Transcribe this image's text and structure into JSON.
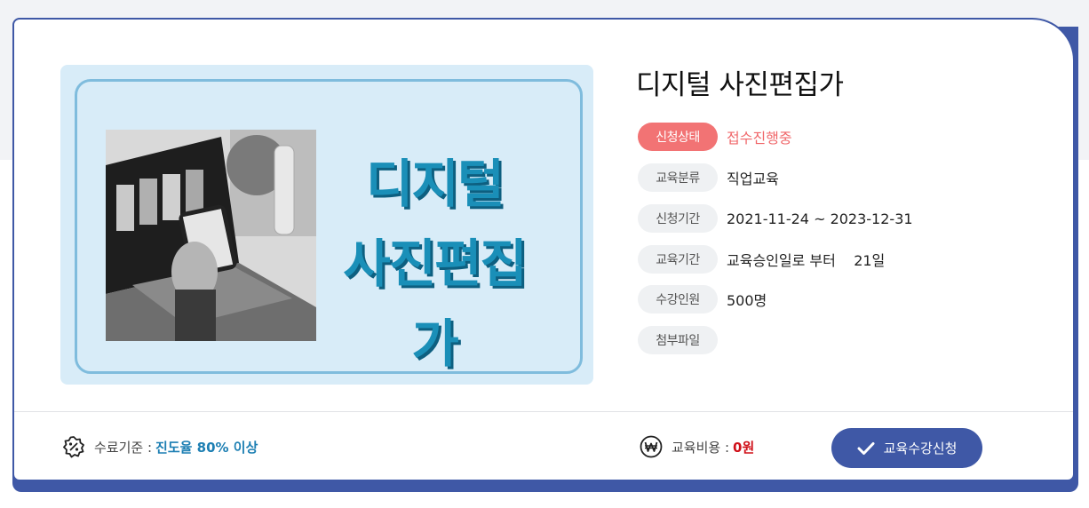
{
  "course": {
    "title": "디지털 사진편집가",
    "thumbnail_text_line1": "디지털",
    "thumbnail_text_line2": "사진편집가"
  },
  "info": [
    {
      "label": "신청상태",
      "value": "접수진행중"
    },
    {
      "label": "교육분류",
      "value": "직업교육"
    },
    {
      "label": "신청기간",
      "value": "2021-11-24 ~ 2023-12-31"
    },
    {
      "label": "교육기간",
      "value": "교육승인일로 부터    21일"
    },
    {
      "label": "수강인원",
      "value": "500명"
    },
    {
      "label": "첨부파일",
      "value": ""
    }
  ],
  "footer": {
    "completion_label": "수료기준 :",
    "completion_value": "진도율 80% 이상",
    "fee_label": "교육비용 :",
    "fee_value": "0원",
    "apply_label": "교육수강신청"
  },
  "icons": {
    "completion": "badge-percent-icon",
    "fee": "won-icon",
    "apply": "check-icon"
  },
  "colors": {
    "primary": "#3f58a6",
    "status_pill": "#f27374",
    "status_text": "#f0676a",
    "highlight": "#1d7fb3",
    "fee": "#d0111a",
    "thumb_bg": "#d8ecf8",
    "thumb_text": "#1a8fb8"
  }
}
